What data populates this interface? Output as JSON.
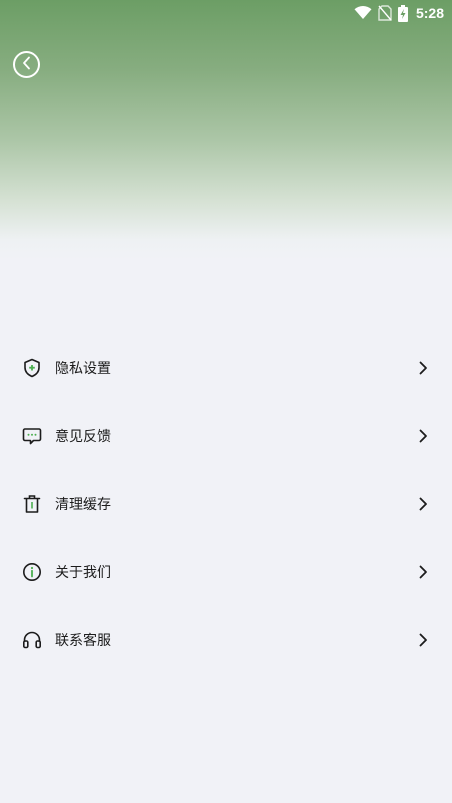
{
  "status_bar": {
    "time": "5:28",
    "icons": [
      "wifi-icon",
      "no-sim-icon",
      "battery-charging-icon"
    ]
  },
  "header": {
    "back_icon": "back-arrow-icon"
  },
  "menu": {
    "items": [
      {
        "label": "隐私设置",
        "icon": "shield-icon"
      },
      {
        "label": "意见反馈",
        "icon": "feedback-icon"
      },
      {
        "label": "清理缓存",
        "icon": "trash-icon"
      },
      {
        "label": "关于我们",
        "icon": "info-icon"
      },
      {
        "label": "联系客服",
        "icon": "headset-icon"
      }
    ]
  },
  "colors": {
    "header_green": "#6c9e65",
    "background": "#f1f2f7",
    "shield_accent": "#4caf50",
    "text": "#1c1c1c"
  }
}
